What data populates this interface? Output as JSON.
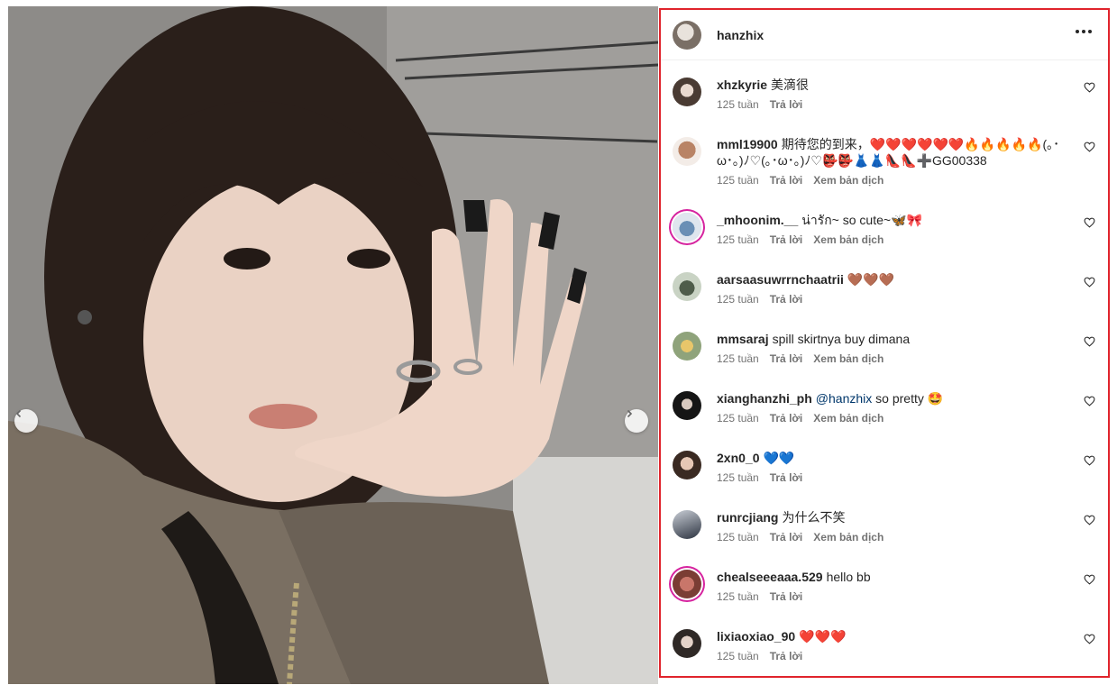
{
  "post": {
    "author": "hanzhix",
    "more_label": "More options"
  },
  "comments": [
    {
      "user": "xhzkyrie",
      "text": "美滴很",
      "time": "125 tuần",
      "reply": "Trả lời",
      "translate": ""
    },
    {
      "user": "mml19900",
      "text": "期待您的到来，❤️❤️❤️❤️❤️❤️🔥🔥🔥🔥🔥(｡･ω･｡)ﾉ♡(｡･ω･｡)ﾉ♡👺👺👗👗👠👠➕GG00338",
      "time": "125 tuần",
      "reply": "Trả lời",
      "translate": "Xem bản dịch"
    },
    {
      "user": "_mhoonim.__",
      "text": "น่ารัก~ so cute~🦋🎀",
      "time": "125 tuần",
      "reply": "Trả lời",
      "translate": "Xem bản dịch"
    },
    {
      "user": "aarsaasuwrrnchaatrii",
      "text": "🤎🤎🤎",
      "time": "125 tuần",
      "reply": "Trả lời",
      "translate": ""
    },
    {
      "user": "mmsaraj",
      "text": "spill skirtnya buy dimana",
      "time": "125 tuần",
      "reply": "Trả lời",
      "translate": "Xem bản dịch"
    },
    {
      "user": "xianghanzhi_ph",
      "mention": "@hanzhix",
      "text": " so pretty 🤩",
      "time": "125 tuần",
      "reply": "Trả lời",
      "translate": "Xem bản dịch"
    },
    {
      "user": "2xn0_0",
      "text": "💙💙",
      "time": "125 tuần",
      "reply": "Trả lời",
      "translate": ""
    },
    {
      "user": "runrcjiang",
      "text": "为什么不笑",
      "time": "125 tuần",
      "reply": "Trả lời",
      "translate": "Xem bản dịch"
    },
    {
      "user": "chealseeeaaa.529",
      "text": "hello bb",
      "time": "125 tuần",
      "reply": "Trả lời",
      "translate": ""
    },
    {
      "user": "lixiaoxiao_90",
      "text": "❤️❤️❤️",
      "time": "125 tuần",
      "reply": "Trả lời",
      "translate": ""
    }
  ],
  "colors": {
    "highlight_border": "#e0242c",
    "mention": "#00376b",
    "meta": "#737373"
  }
}
